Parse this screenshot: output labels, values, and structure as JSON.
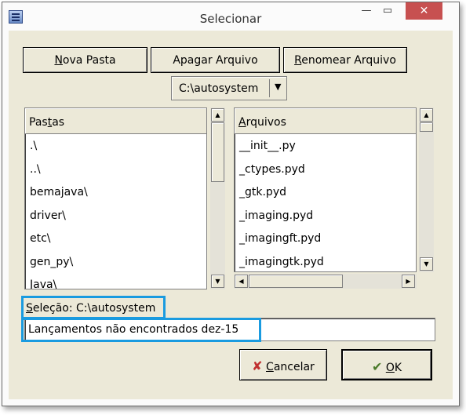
{
  "window": {
    "title": "Selecionar",
    "min_glyph": "—",
    "max_glyph": "▭",
    "close_glyph": "✕"
  },
  "toolbar": {
    "new_folder": {
      "accel": "N",
      "rest": "ova Pasta"
    },
    "delete_file": "Apagar Arquivo",
    "rename_file": {
      "accel": "R",
      "rest": "enomear Arquivo"
    }
  },
  "drive_combo": {
    "value": "C:\\autosystem",
    "arrow": "▼"
  },
  "folders": {
    "header": {
      "pre": "Pas",
      "accel": "t",
      "post": "as"
    },
    "items": [
      ".\\",
      "..\\",
      "bemajava\\",
      "driver\\",
      "etc\\",
      "gen_py\\",
      "Java\\"
    ]
  },
  "files": {
    "header": {
      "accel": "A",
      "rest": "rquivos"
    },
    "items": [
      "__init__.py",
      "_ctypes.pyd",
      "_gtk.pyd",
      "_imaging.pyd",
      "_imagingft.pyd",
      "_imagingtk.pyd"
    ]
  },
  "selection": {
    "accel": "S",
    "rest": "eleção: C:\\autosystem"
  },
  "message_field": {
    "value": "Lançamentos não encontrados dez-15"
  },
  "buttons": {
    "cancel": {
      "accel": "C",
      "rest": "ancelar"
    },
    "ok": {
      "accel": "O",
      "rest": "K"
    }
  },
  "colors": {
    "highlight": "#1a9be0",
    "close": "#c75050",
    "face": "#ece9d8"
  }
}
